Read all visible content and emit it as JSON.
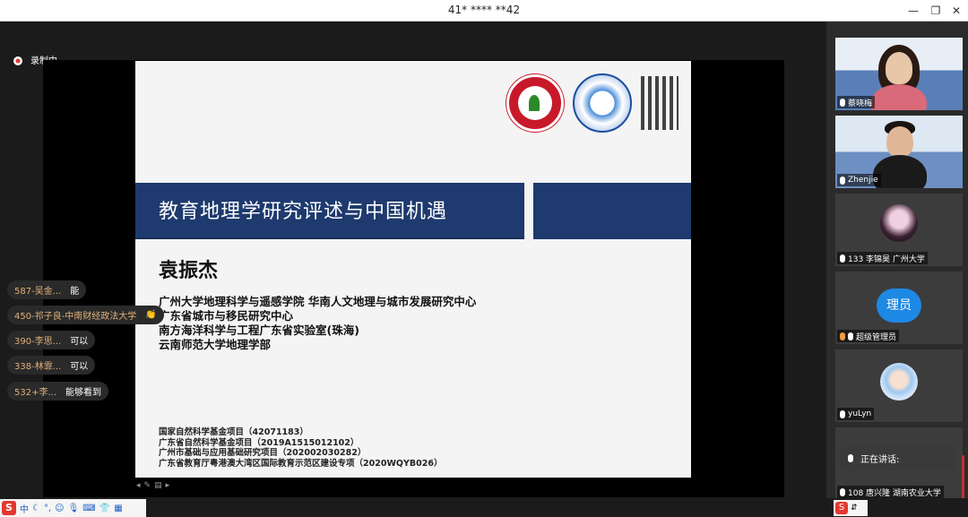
{
  "window": {
    "title": "41* **** **42"
  },
  "recording": {
    "label": "录制中"
  },
  "slide": {
    "title": "教育地理学研究评述与中国机遇",
    "author": "袁振杰",
    "affiliations": [
      "广州大学地理科学与遥感学院 华南人文地理与城市发展研究中心",
      "广东省城市与移民研究中心",
      "南方海洋科学与工程广东省实验室(珠海)",
      "云南师范大学地理学部"
    ],
    "funding": [
      "国家自然科学基金项目（42071183）",
      "广东省自然科学基金项目（2019A1515012102）",
      "广州市基础与应用基础研究项目（202002030282）",
      "广东省教育厅粤港澳大湾区国际教育示范区建设专项（2020WQYB026）"
    ]
  },
  "chat": [
    {
      "who": "587-吴金...",
      "msg": "能"
    },
    {
      "who": "450-祁子良-中南财经政法大学",
      "msg": "👏"
    },
    {
      "who": "390-李思...",
      "msg": "可以"
    },
    {
      "who": "338-林霏...",
      "msg": "可以"
    },
    {
      "who": "532+李...",
      "msg": "能够看到"
    }
  ],
  "participants": [
    {
      "name": "蔡晓梅",
      "type": "video1"
    },
    {
      "name": "Zhenjie",
      "type": "video2"
    },
    {
      "name": "133 李锦昊 广州大学",
      "type": "avatar"
    },
    {
      "name": "超级管理员",
      "type": "badge",
      "badge_text": "理员"
    },
    {
      "name": "yuLyn",
      "type": "avatar2"
    },
    {
      "name": "108 唐兴隆 湖南农业大学",
      "type": "empty"
    }
  ],
  "speaking": {
    "label": "正在讲话:"
  },
  "ime": {
    "lang": "中"
  },
  "colors": {
    "band": "#1e3a6e",
    "badge": "#1e88e5",
    "chat_name": "#e0b07a"
  }
}
